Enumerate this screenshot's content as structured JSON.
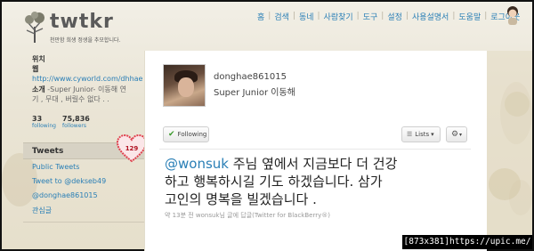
{
  "header": {
    "logo_text": "twtkr",
    "tagline": "천만함 희생 정생을 추모합니다.",
    "nav": [
      "홈",
      "검색",
      "동네",
      "사람찾기",
      "도구",
      "설정",
      "사용설명서",
      "도움말",
      "로그아웃"
    ]
  },
  "sidebar": {
    "location_label": "위치",
    "web_label": "웹",
    "web_url": "http://www.cyworld.com/dhhae",
    "bio_label": "소개",
    "bio_text_1": "-Super Junior- 이동해 연",
    "bio_text_2": "기 , 무대 , 버릴수 없다 . .",
    "following_count": "33",
    "following_label": "following",
    "followers_count": "75,836",
    "followers_label": "followers",
    "tweets_label": "Tweets",
    "badge_count": "129",
    "public_tweets": "Public Tweets",
    "tweet_to": "Tweet to @dekseb49",
    "mention": "@donghae861015",
    "favorites": "관심글"
  },
  "profile": {
    "username": "donghae861015",
    "realname": "Super Junior 이동해"
  },
  "actions": {
    "follow_label": "Following",
    "lists_label": "Lists",
    "lists_caret": "▾",
    "gear_caret": "▾"
  },
  "tweet": {
    "mention": "@wonsuk",
    "line1_rest": " 주님 옆에서 지금보다 더 건강",
    "line2": "하고 행복하시길 기도 하겠습니다. 삼가",
    "line3": "고인의 명복을 빌겠습니다 .",
    "meta": "약 13분 전 wonsuk님 글에 답글(Twitter for BlackBerry®)"
  },
  "watermark": "[873x381]https://upic.me/",
  "colors": {
    "link": "#2a7fb6",
    "heart": "#e0404e",
    "background": "#e9e4d4"
  }
}
